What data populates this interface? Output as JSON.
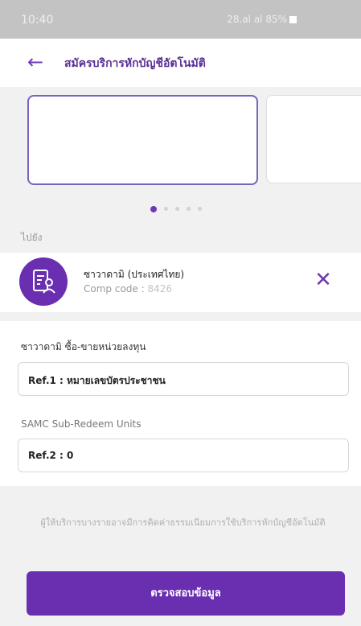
{
  "status_bar": {
    "time": "10:40",
    "indicators": "28.al al 85%"
  },
  "header": {
    "title": "สมัครบริการหักบัญชีอัตโนมัติ",
    "back_icon": "arrow-left-icon"
  },
  "carousel": {
    "page_count": 5,
    "active_index": 0
  },
  "payee_section_label": "ไปยัง",
  "payee": {
    "name": "ซาวาดามิ (ประเทศไทย)",
    "code_label": "Comp code :",
    "code_value": "8426",
    "icon": "document-person-icon"
  },
  "ref1": {
    "label": "ซาวาดามิ ซื้อ-ขายหน่วยลงทุน",
    "value": "Ref.1 : หมายเลขบัตรประชาชน"
  },
  "ref2": {
    "label": "SAMC Sub-Redeem Units",
    "value": "Ref.2 : 0"
  },
  "note": "ผู้ให้บริการบางรายอาจมีการคิดค่าธรรมเนียมการใช้บริการหักบัญชีอัตโนมัติ",
  "submit_label": "ตรวจสอบข้อมูล",
  "colors": {
    "accent": "#6a2fb0",
    "background": "#f1f1f1"
  }
}
